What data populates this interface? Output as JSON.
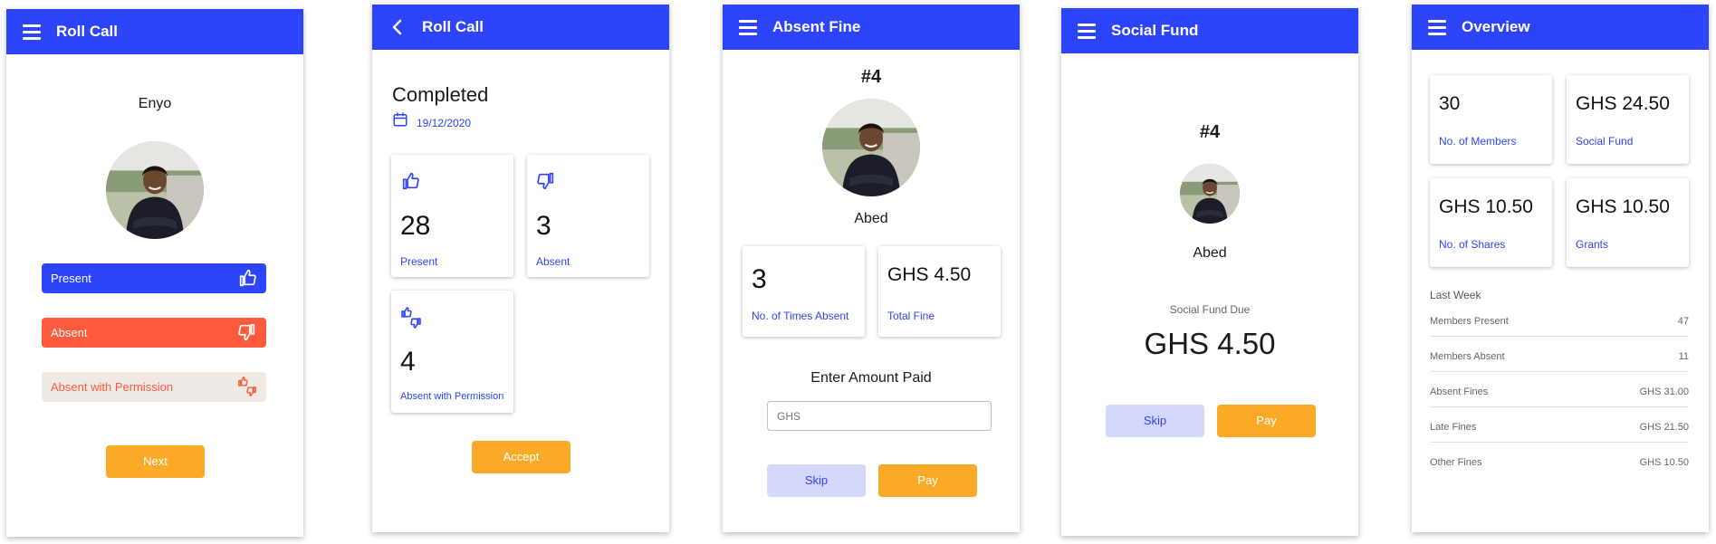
{
  "colors": {
    "primary": "#2e44fa",
    "accent": "#fbaa27",
    "danger": "#ff5a3c",
    "muted_bg": "#efeae6",
    "skip_bg": "#d4d9fb"
  },
  "screen1": {
    "title": "Roll Call",
    "menu_icon": "hamburger-menu-icon",
    "member_name": "Enyo",
    "buttons": {
      "present": {
        "label": "Present",
        "icon": "thumbs-up-icon"
      },
      "absent": {
        "label": "Absent",
        "icon": "thumbs-down-icon"
      },
      "permission": {
        "label": "Absent with Permission",
        "icon": "thumbs-up-down-icon"
      }
    },
    "next_label": "Next"
  },
  "screen2": {
    "title": "Roll Call",
    "back_icon": "chevron-left-icon",
    "heading": "Completed",
    "date": "19/12/2020",
    "cards": {
      "present": {
        "value": "28",
        "label": "Present",
        "icon": "thumbs-up-icon"
      },
      "absent": {
        "value": "3",
        "label": "Absent",
        "icon": "thumbs-down-icon"
      },
      "permission": {
        "value": "4",
        "label": "Absent with Permission",
        "icon": "thumbs-up-down-icon"
      }
    },
    "accept_label": "Accept"
  },
  "screen3": {
    "title": "Absent Fine",
    "number": "#4",
    "member_name": "Abed",
    "times_absent": {
      "value": "3",
      "label": "No. of Times Absent"
    },
    "total_fine": {
      "value": "GHS 4.50",
      "label": "Total Fine"
    },
    "enter_amount_label": "Enter Amount Paid",
    "amount_placeholder": "GHS",
    "skip_label": "Skip",
    "pay_label": "Pay"
  },
  "screen4": {
    "title": "Social Fund",
    "number": "#4",
    "member_name": "Abed",
    "due_label": "Social Fund Due",
    "due_value": "GHS 4.50",
    "skip_label": "Skip",
    "pay_label": "Pay"
  },
  "screen5": {
    "title": "Overview",
    "stats": {
      "members": {
        "value": "30",
        "label": "No. of Members"
      },
      "social_fund": {
        "value": "GHS 24.50",
        "label": "Social Fund"
      },
      "shares": {
        "value": "GHS 10.50",
        "label": "No. of Shares"
      },
      "grants": {
        "value": "GHS 10.50",
        "label": "Grants"
      }
    },
    "last_week_label": "Last Week",
    "last_week": [
      {
        "label": "Members Present",
        "value": "47"
      },
      {
        "label": "Members Absent",
        "value": "11"
      },
      {
        "label": "Absent Fines",
        "value": "GHS 31.00"
      },
      {
        "label": "Late Fines",
        "value": "GHS 21.50"
      },
      {
        "label": "Other Fines",
        "value": "GHS 10.50"
      }
    ]
  }
}
